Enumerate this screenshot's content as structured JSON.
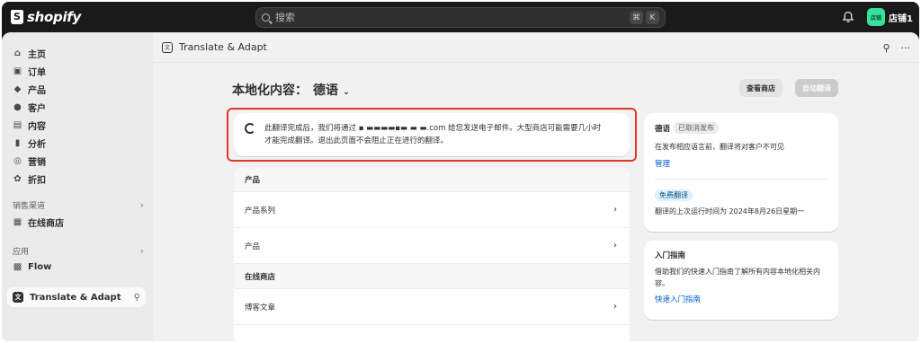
{
  "topbar": {
    "logo_text": "shopify",
    "search_placeholder": "搜索",
    "shortcut_keys": [
      "⌘",
      "K"
    ],
    "store_avatar_text": "店铺",
    "store_name": "店铺1"
  },
  "sidebar": {
    "items": [
      {
        "label": "主页",
        "icon": "home-icon"
      },
      {
        "label": "订单",
        "icon": "orders-icon"
      },
      {
        "label": "产品",
        "icon": "tag-icon"
      },
      {
        "label": "客户",
        "icon": "person-icon"
      },
      {
        "label": "内容",
        "icon": "content-icon"
      },
      {
        "label": "分析",
        "icon": "analytics-icon"
      },
      {
        "label": "营销",
        "icon": "marketing-icon"
      },
      {
        "label": "折扣",
        "icon": "discount-icon"
      }
    ],
    "sales_channels_label": "销售渠道",
    "online_store_label": "在线商店",
    "apps_label": "应用",
    "flow_label": "Flow",
    "active_app_label": "Translate & Adapt"
  },
  "header": {
    "app_title": "Translate & Adapt",
    "more_label": "···"
  },
  "page": {
    "title": "本地化内容：",
    "language": "德语",
    "view_store_button": "查看商店",
    "auto_translate_button": "自动翻译"
  },
  "notice": {
    "line1": "此翻译完成后，我们将通过 ▪ ▬▬▬▬▪▬  ▬ ▬.com 给您发送电子邮件。大型商店可能需要几小时",
    "line2": "才能完成翻译。退出此页面不会阻止正在进行的翻译。"
  },
  "list": {
    "rows": [
      {
        "label": "产品",
        "type": "header"
      },
      {
        "label": "产品系列",
        "type": "item"
      },
      {
        "label": "产品",
        "type": "item"
      },
      {
        "label": "在线商店",
        "type": "header"
      },
      {
        "label": "博客文章",
        "type": "item"
      }
    ]
  },
  "language_card": {
    "title": "德语",
    "status_badge": "已取消发布",
    "description": "在发布相应语言前，翻译将对客户不可见",
    "manage_link": "管理",
    "free_badge": "免费翻译",
    "last_run": "翻译的上次运行时间为 2024年8月26日星期一"
  },
  "guide_card": {
    "title": "入门指南",
    "description": "借助我们的快速入门指南了解所有内容本地化相关内容。",
    "link": "快速入门指南"
  },
  "colors": {
    "topbar_bg": "#1a1a1a",
    "highlight_outline": "#e0392b",
    "link": "#005bd3",
    "store_avatar": "#36e29a"
  }
}
